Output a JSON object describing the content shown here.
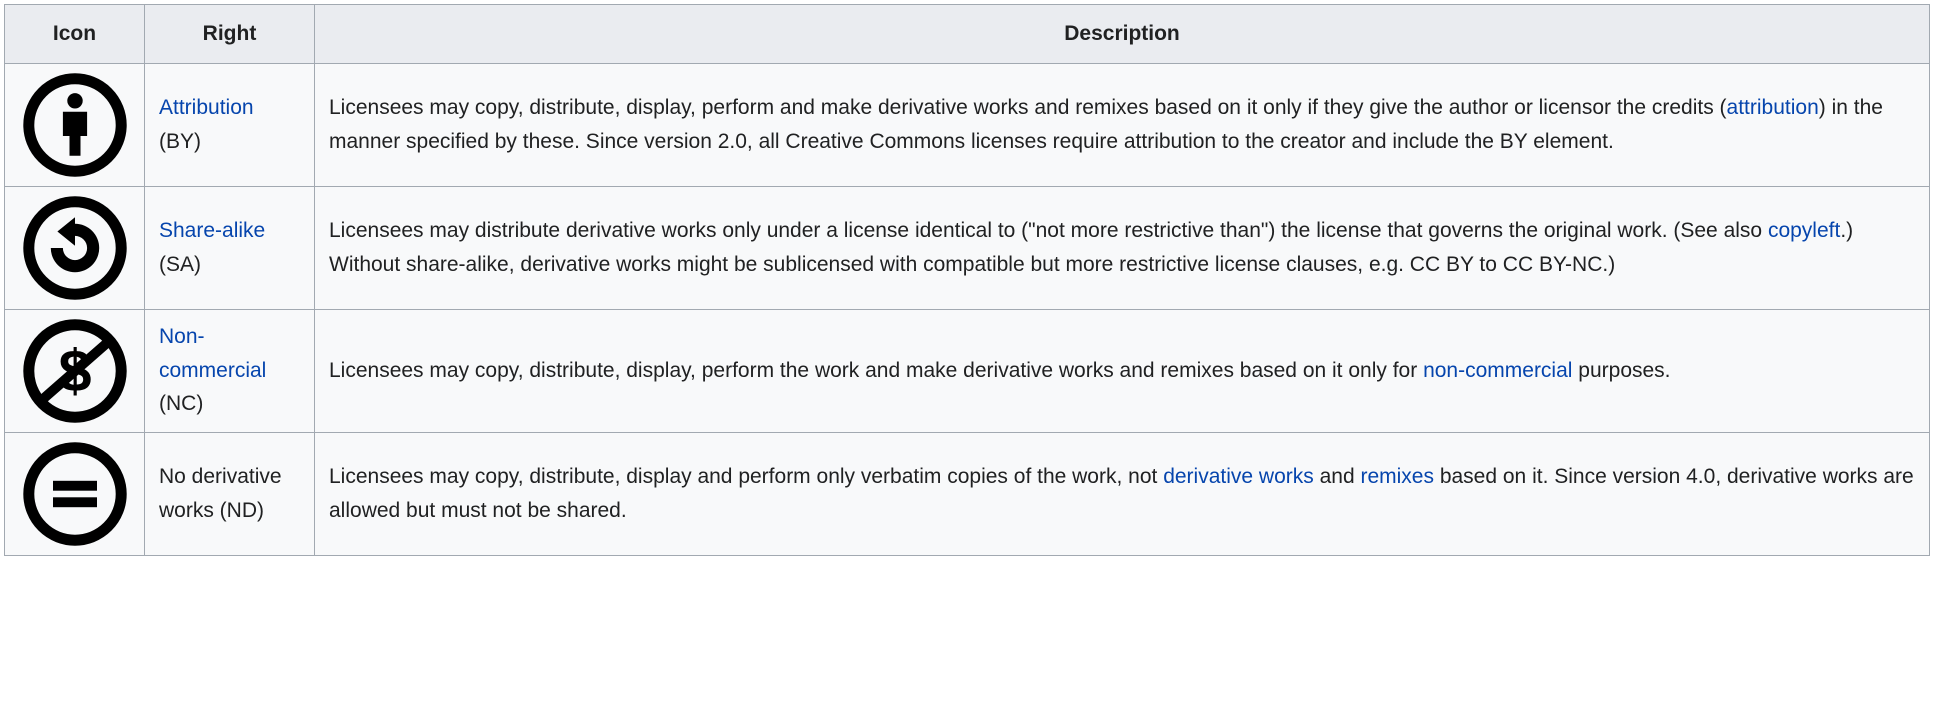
{
  "headers": {
    "icon": "Icon",
    "right": "Right",
    "description": "Description"
  },
  "rows": [
    {
      "icon_name": "attribution-icon",
      "right_link": "Attribution",
      "right_suffix": " (BY)",
      "right_has_link": true,
      "desc_parts": [
        {
          "type": "text",
          "value": "Licensees may copy, distribute, display, perform and make derivative works and remixes based on it only if they give the author or licensor the credits ("
        },
        {
          "type": "link",
          "value": "attribution"
        },
        {
          "type": "text",
          "value": ") in the manner specified by these. Since version 2.0, all Creative Commons licenses require attribution to the creator and include the BY element."
        }
      ]
    },
    {
      "icon_name": "share-alike-icon",
      "right_link": "Share-alike",
      "right_suffix": " (SA)",
      "right_has_link": true,
      "desc_parts": [
        {
          "type": "text",
          "value": "Licensees may distribute derivative works only under a license identical to (\"not more restrictive than\") the license that governs the original work. (See also "
        },
        {
          "type": "link",
          "value": "copyleft"
        },
        {
          "type": "text",
          "value": ".) Without share-alike, derivative works might be sublicensed with compatible but more restrictive license clauses, e.g. CC BY to CC BY-NC.)"
        }
      ]
    },
    {
      "icon_name": "non-commercial-icon",
      "right_link": "Non-commercial",
      "right_suffix": " (NC)",
      "right_has_link": true,
      "desc_parts": [
        {
          "type": "text",
          "value": "Licensees may copy, distribute, display, perform the work and make derivative works and remixes based on it only for "
        },
        {
          "type": "link",
          "value": "non-commercial"
        },
        {
          "type": "text",
          "value": " purposes."
        }
      ]
    },
    {
      "icon_name": "no-derivatives-icon",
      "right_link": "No derivative works",
      "right_suffix": " (ND)",
      "right_has_link": false,
      "desc_parts": [
        {
          "type": "text",
          "value": "Licensees may copy, distribute, display and perform only verbatim copies of the work, not "
        },
        {
          "type": "link",
          "value": "derivative works"
        },
        {
          "type": "text",
          "value": " and "
        },
        {
          "type": "link",
          "value": "remixes"
        },
        {
          "type": "text",
          "value": " based on it. Since version 4.0, derivative works are allowed but must not be shared."
        }
      ]
    }
  ]
}
